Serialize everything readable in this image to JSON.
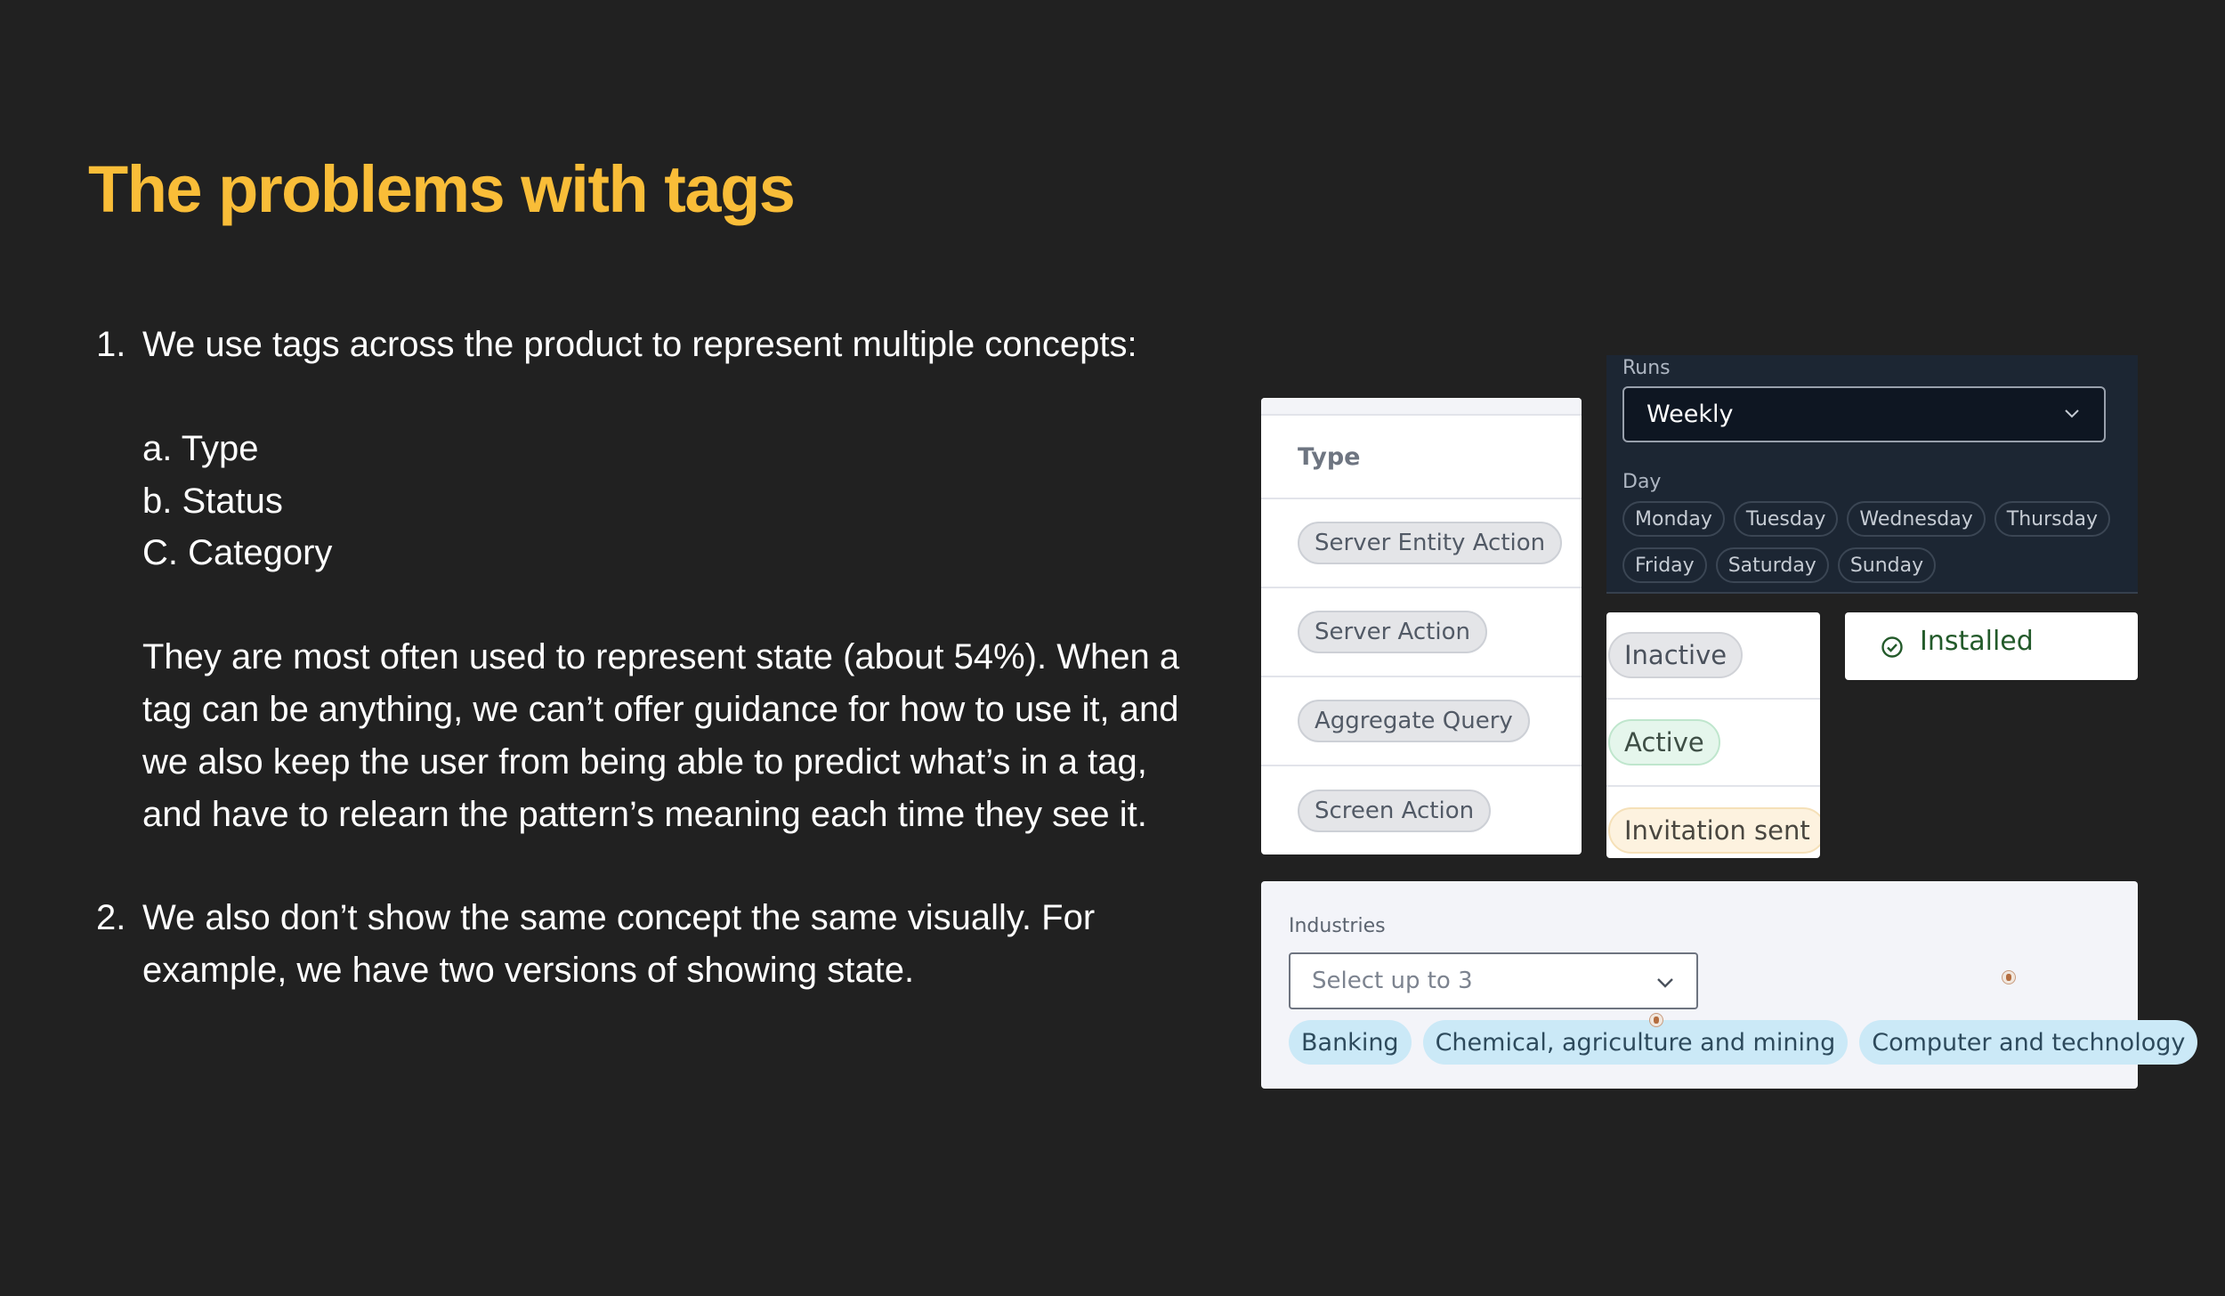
{
  "title": "The problems with tags",
  "body": {
    "item1": {
      "num": "1.",
      "text": "We use tags across the product to represent multiple concepts:",
      "subitems": [
        "a. Type",
        "b. Status",
        "C. Category"
      ],
      "paragraph": "They are most often used to represent state (about 54%). When a tag can be anything, we can’t offer guidance for how to use it, and we also keep the user from being able to predict what’s in a tag, and have to relearn the pattern’s meaning each time they see it."
    },
    "item2": {
      "num": "2.",
      "text": "We also don’t show the same concept the same visually. For example, we have two versions of showing state."
    }
  },
  "runs_panel": {
    "runs_label": "Runs",
    "runs_value": "Weekly",
    "day_label": "Day",
    "days": [
      "Monday",
      "Tuesday",
      "Wednesday",
      "Thursday",
      "Friday",
      "Saturday",
      "Sunday"
    ]
  },
  "type_table": {
    "header": "Type",
    "rows": [
      "Server Entity Action",
      "Server Action",
      "Aggregate Query",
      "Screen Action"
    ]
  },
  "status_table": {
    "rows": [
      "Inactive",
      "Active",
      "Invitation sent"
    ]
  },
  "installed": {
    "label": "Installed",
    "icon": "check-circle-icon"
  },
  "industries": {
    "label": "Industries",
    "placeholder": "Select up to 3",
    "chips": [
      "Banking",
      "Chemical, agriculture and mining",
      "Computer and technology"
    ]
  },
  "colors": {
    "background": "#212121",
    "title": "#f9bd38",
    "text": "#ffffff",
    "runs_panel": "#1c2633",
    "industry_chip": "#cbe9f7",
    "installed_text": "#235a2a"
  }
}
